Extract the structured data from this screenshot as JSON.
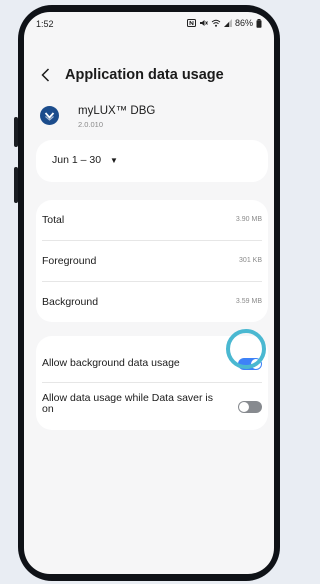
{
  "status_bar": {
    "time": "1:52",
    "battery": "86%"
  },
  "header": {
    "title": "Application data usage"
  },
  "app": {
    "name": "myLUX™ DBG",
    "version": "2.0.010"
  },
  "date_range": {
    "label": "Jun 1 – 30",
    "caret": "▼"
  },
  "usage": {
    "rows": [
      {
        "label": "Total",
        "value": "3.90 MB"
      },
      {
        "label": "Foreground",
        "value": "301 KB"
      },
      {
        "label": "Background",
        "value": "3.59 MB"
      }
    ]
  },
  "toggles": {
    "background": {
      "label": "Allow background data usage",
      "state": "on"
    },
    "data_saver": {
      "label": "Allow data usage while Data saver is on",
      "state": "off"
    }
  },
  "colors": {
    "accent": "#3e82f7",
    "highlight_ring": "#4ab8d1",
    "app_icon_bg": "#1b4c8c"
  }
}
